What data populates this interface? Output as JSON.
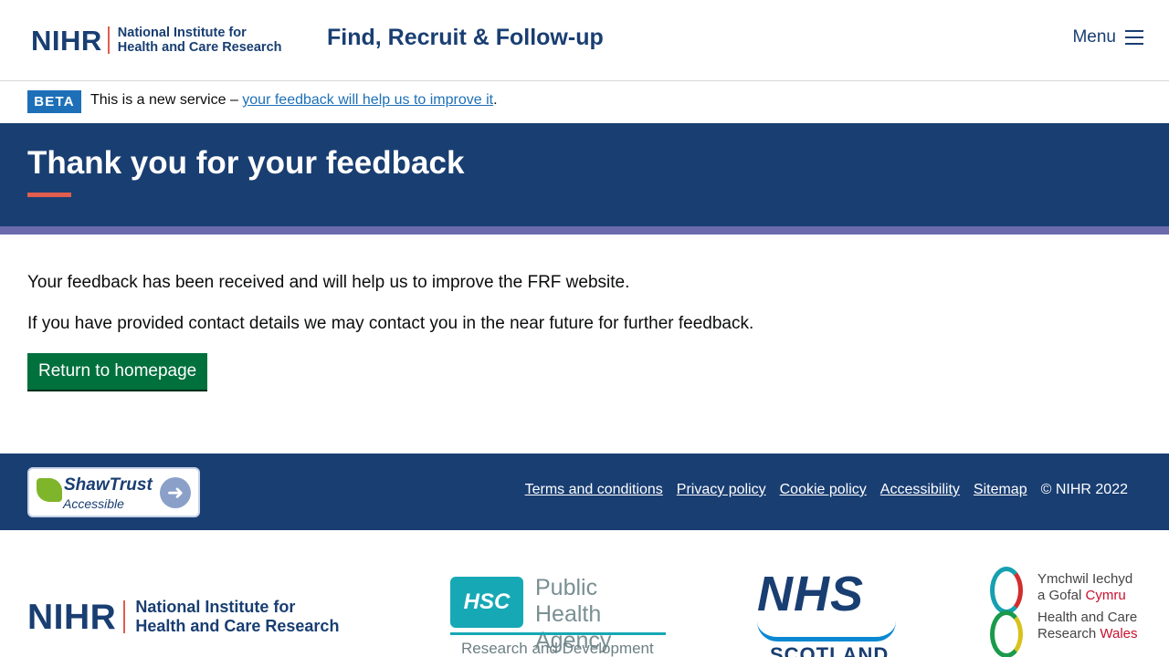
{
  "header": {
    "logo_acronym": "NIHR",
    "logo_line1": "National Institute for",
    "logo_line2": "Health and Care Research",
    "service_name": "Find, Recruit & Follow-up",
    "menu_label": "Menu",
    "menu_icon": "hamburger-icon"
  },
  "beta": {
    "tag": "BETA",
    "text_before": "This is a new service – ",
    "link_text": "your feedback will help us to improve it",
    "text_after": "."
  },
  "hero": {
    "title": "Thank you for your feedback"
  },
  "main": {
    "paragraph1": "Your feedback has been received and will help us to improve the FRF website.",
    "paragraph2": "If you have provided contact details we may contact you in the near future for further feedback.",
    "button_label": "Return to homepage"
  },
  "footer": {
    "shaw_trust_name": "ShawTrust",
    "shaw_trust_sub": "Accessible",
    "links": [
      "Terms and conditions",
      "Privacy policy",
      "Cookie policy",
      "Accessibility",
      "Sitemap"
    ],
    "copyright": "© NIHR 2022"
  },
  "partners": {
    "nihr_acronym": "NIHR",
    "nihr_line1": "National Institute for",
    "nihr_line2": "Health and Care Research",
    "hsc_mark": "HSC",
    "hsc_line1": "Public Health",
    "hsc_line2": "Agency",
    "hsc_sub": "Research and Development",
    "nhs_mark": "NHS",
    "nhs_sub": "SCOTLAND",
    "wales_line1": "Ymchwil Iechyd",
    "wales_line2a": "a Gofal ",
    "wales_line2b": "Cymru",
    "wales_line3": "Health and Care",
    "wales_line4a": "Research ",
    "wales_line4b": "Wales"
  },
  "colors": {
    "brand_navy": "#193e72",
    "accent_coral": "#e05d4f",
    "stripe_purple": "#6a6aad",
    "button_green": "#00703c",
    "link_blue": "#1d70b8"
  }
}
